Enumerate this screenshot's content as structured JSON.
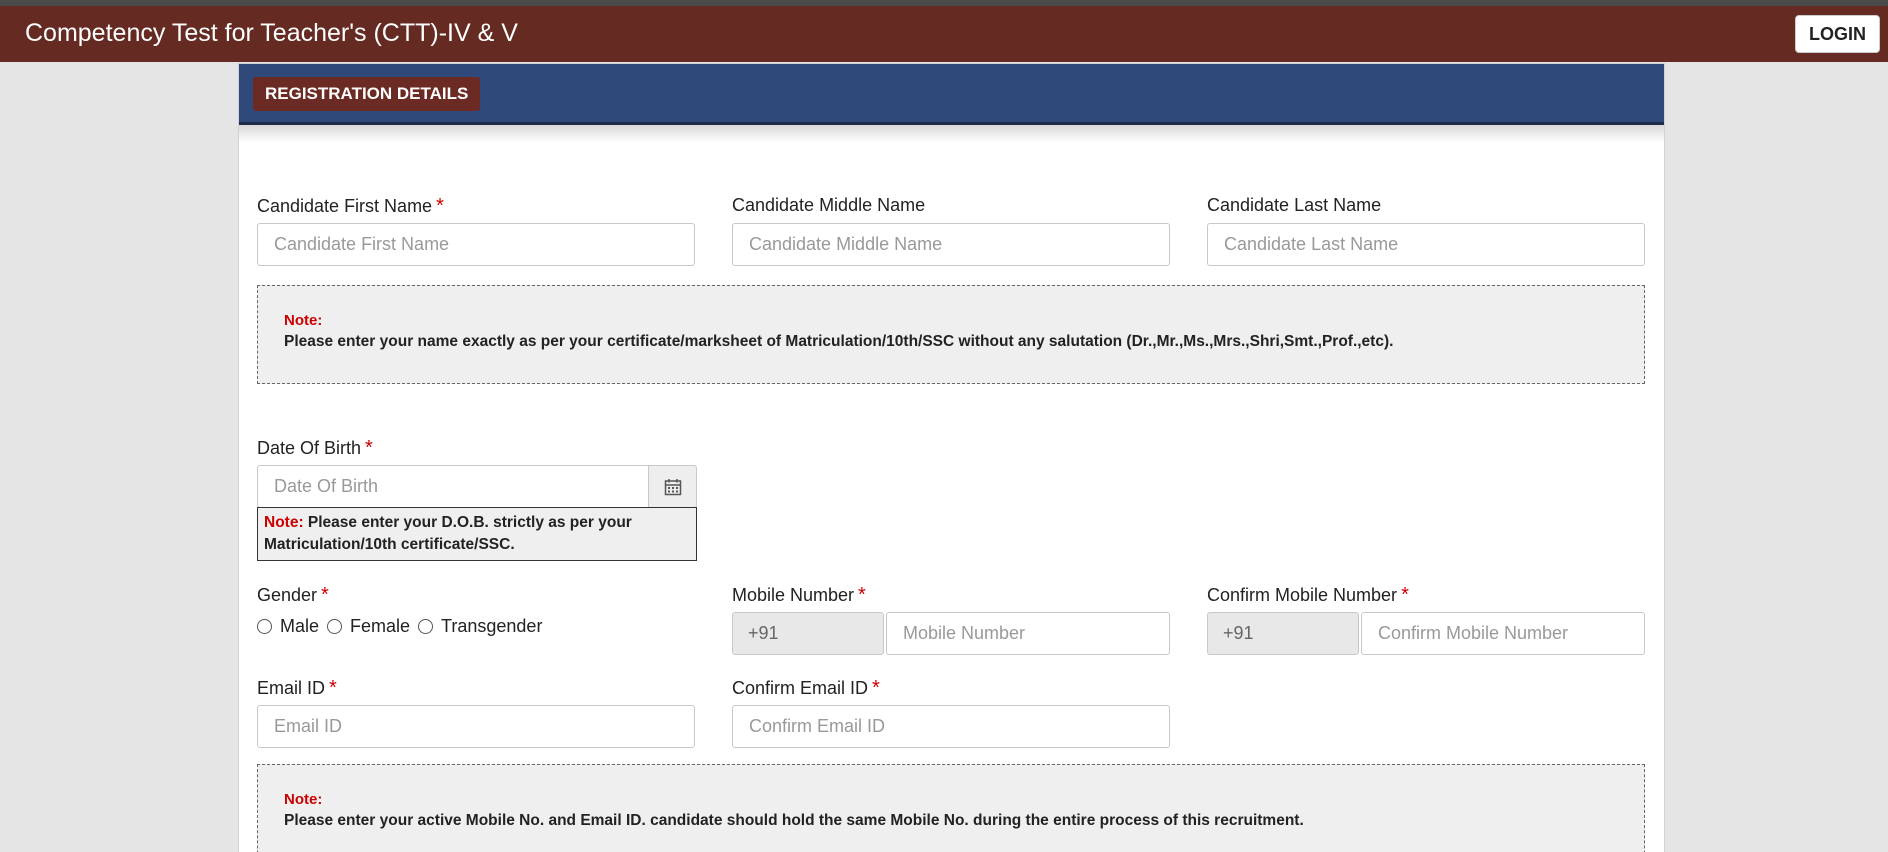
{
  "header": {
    "title": "Competency Test for Teacher's (CTT)-IV & V",
    "login_label": "LOGIN"
  },
  "section": {
    "title": "REGISTRATION DETAILS"
  },
  "fields": {
    "first_name": {
      "label": "Candidate First Name",
      "placeholder": "Candidate First Name",
      "required": "*"
    },
    "middle_name": {
      "label": "Candidate Middle Name",
      "placeholder": "Candidate Middle Name"
    },
    "last_name": {
      "label": "Candidate Last Name",
      "placeholder": "Candidate Last Name"
    },
    "dob": {
      "label": "Date Of Birth",
      "placeholder": "Date Of Birth",
      "required": "*"
    },
    "gender": {
      "label": "Gender",
      "required": "*",
      "options": [
        "Male",
        "Female",
        "Transgender"
      ]
    },
    "mobile": {
      "label": "Mobile Number",
      "prefix": "+91",
      "placeholder": "Mobile Number",
      "required": "*"
    },
    "confirm_mobile": {
      "label": "Confirm Mobile Number",
      "prefix": "+91",
      "placeholder": "Confirm Mobile Number",
      "required": "*"
    },
    "email": {
      "label": "Email ID",
      "placeholder": "Email ID",
      "required": "*"
    },
    "confirm_email": {
      "label": "Confirm Email ID",
      "placeholder": "Confirm Email ID",
      "required": "*"
    }
  },
  "notes": {
    "name_note": {
      "title": "Note:",
      "text": "Please enter your name exactly as per your certificate/marksheet of Matriculation/10th/SSC without any salutation (Dr.,Mr.,Ms.,Mrs.,Shri,Smt.,Prof.,etc)."
    },
    "dob_note": {
      "title": "Note:",
      "text": " Please enter your D.O.B. strictly as per your Matriculation/10th certificate/SSC."
    },
    "contact_note": {
      "title": "Note:",
      "text": "Please enter your active Mobile No. and Email ID. candidate should hold the same Mobile No. during the entire process of this recruitment."
    }
  },
  "icons": {
    "calendar": "calendar-icon"
  },
  "colors": {
    "topbar": "#652a22",
    "card_header": "#2f4a7a",
    "badge": "#6b2a24",
    "required": "#cc0000"
  }
}
